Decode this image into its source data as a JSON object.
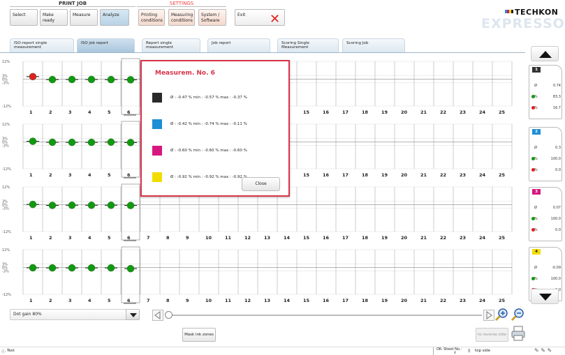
{
  "header": {
    "print_job_label": "PRINT JOB",
    "settings_label": "SETTINGS",
    "buttons": {
      "select": "Select",
      "make_ready": "Make ready",
      "measure": "Measure",
      "analyze": "Analyze",
      "printing_conditions": "Printing conditions",
      "measuring_conditions": "Measuring conditions",
      "system_software": "System / Software",
      "exit": "Exit"
    },
    "logo_top": "TECHKON",
    "logo_bottom": "EXPRESSO"
  },
  "tabs": [
    {
      "label": "ISO-report single measurement",
      "active": false
    },
    {
      "label": "ISO job report",
      "active": true
    },
    {
      "label": "Report single measurement",
      "active": false
    },
    {
      "label": "Job report",
      "active": false
    },
    {
      "label": "Scoring Single Measurement",
      "active": false
    },
    {
      "label": "Scoring Job",
      "active": false
    }
  ],
  "chart_data": {
    "type": "scatter",
    "y_ticks": [
      "12%",
      "3%",
      "0%",
      "-3%",
      "-12%"
    ],
    "ylim": [
      -12,
      12
    ],
    "x_labels": [
      "1",
      "2",
      "3",
      "4",
      "5",
      "6",
      "7",
      "8",
      "9",
      "10",
      "11",
      "12",
      "13",
      "14",
      "15",
      "16",
      "17",
      "18",
      "19",
      "20",
      "21",
      "22",
      "23",
      "24",
      "25"
    ],
    "selected_measurement": 6,
    "series": [
      {
        "name": "1",
        "color": "#333333",
        "values": [
          2.2,
          -0.3,
          -0.2,
          -0.2,
          -0.3,
          -0.47
        ],
        "point_colors": [
          "#e02020",
          "#119911",
          "#119911",
          "#119911",
          "#119911",
          "#119911"
        ]
      },
      {
        "name": "2",
        "color": "#1e8fd5",
        "values": [
          0.6,
          -0.2,
          -0.3,
          -0.3,
          -0.1,
          -0.42
        ],
        "point_colors": [
          "#119911",
          "#119911",
          "#119911",
          "#119911",
          "#119911",
          "#119911"
        ]
      },
      {
        "name": "3",
        "color": "#d6177f",
        "values": [
          0.3,
          -0.5,
          -0.4,
          -0.4,
          -0.4,
          -0.6
        ],
        "point_colors": [
          "#119911",
          "#119911",
          "#119911",
          "#119911",
          "#119911",
          "#119911"
        ]
      },
      {
        "name": "4",
        "color": "#f2dc00",
        "values": [
          -0.2,
          -0.3,
          -0.3,
          -0.3,
          -0.3,
          -0.92
        ],
        "point_colors": [
          "#119911",
          "#119911",
          "#119911",
          "#119911",
          "#119911",
          "#119911"
        ]
      }
    ]
  },
  "side_cards": [
    {
      "num": "1",
      "chip_color": "#333333",
      "avg": "0.74",
      "green_pct": "83.3",
      "red_pct": "16.7"
    },
    {
      "num": "2",
      "chip_color": "#1e8fd5",
      "avg": "0.3",
      "green_pct": "100.0",
      "red_pct": "0.0"
    },
    {
      "num": "3",
      "chip_color": "#d6177f",
      "avg": "0.07",
      "green_pct": "100.0",
      "red_pct": "0.0"
    },
    {
      "num": "4",
      "chip_color": "#f2dc00",
      "avg": "-0.09",
      "green_pct": "100.0",
      "red_pct": "0.0"
    }
  ],
  "side_labels": {
    "avg": "Ø",
    "pct": "%"
  },
  "modal": {
    "title": "Measurem. No. 6",
    "rows": [
      {
        "color": "#2a2a2a",
        "text": "Ø : -0.47 %   min : -0.57 %   max  : -0.37 %"
      },
      {
        "color": "#1e8fd5",
        "text": "Ø : -0.42 %   min : -0.74 %   max  : -0.11 %"
      },
      {
        "color": "#d6177f",
        "text": "Ø : -0.60 %   min : -0.60 %   max  : -0.60 %"
      },
      {
        "color": "#f2dc00",
        "text": "Ø : -0.92 %   min : -0.92 %   max  : -0.92 %"
      }
    ],
    "close_label": "Close"
  },
  "footer": {
    "dropdown_value": "Dot gain 80%",
    "mask_ink_zones": "Mask ink zones",
    "to_reverse_side": "to reverse side",
    "status_left": "Test",
    "ok_sheet_label": "OK- Sheet No.:",
    "ok_sheet_value": "4",
    "top_side": "top side"
  },
  "colors": {
    "accent_red": "#d8334a",
    "ok_green": "#119911",
    "fail_red": "#e02020"
  }
}
